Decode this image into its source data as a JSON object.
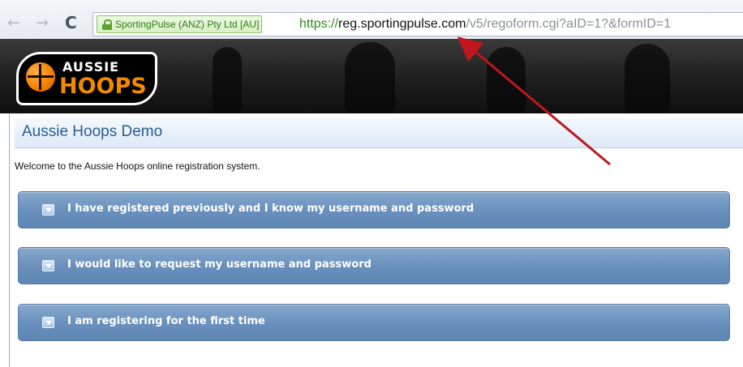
{
  "browser": {
    "back_glyph": "←",
    "forward_glyph": "→",
    "reload_glyph": "C",
    "ev_label": "SportingPulse (ANZ) Pty Ltd [AU]",
    "url_scheme": "https://",
    "url_host": "reg.sportingpulse.com",
    "url_path": "/v5/regoform.cgi?aID=1?&formID=1"
  },
  "banner": {
    "logo_line1": "AUSSIE",
    "logo_line2": "HOOPS"
  },
  "page": {
    "title": "Aussie Hoops Demo",
    "welcome": "Welcome to the Aussie Hoops online registration system."
  },
  "accordion": [
    {
      "label": "I have registered previously and I know my username and password"
    },
    {
      "label": "I would like to request my username and password"
    },
    {
      "label": "I am registering for the first time"
    }
  ],
  "colors": {
    "annotation_arrow": "#c0161c",
    "accordion": "#6a91bd",
    "title_text": "#2a5d92"
  }
}
